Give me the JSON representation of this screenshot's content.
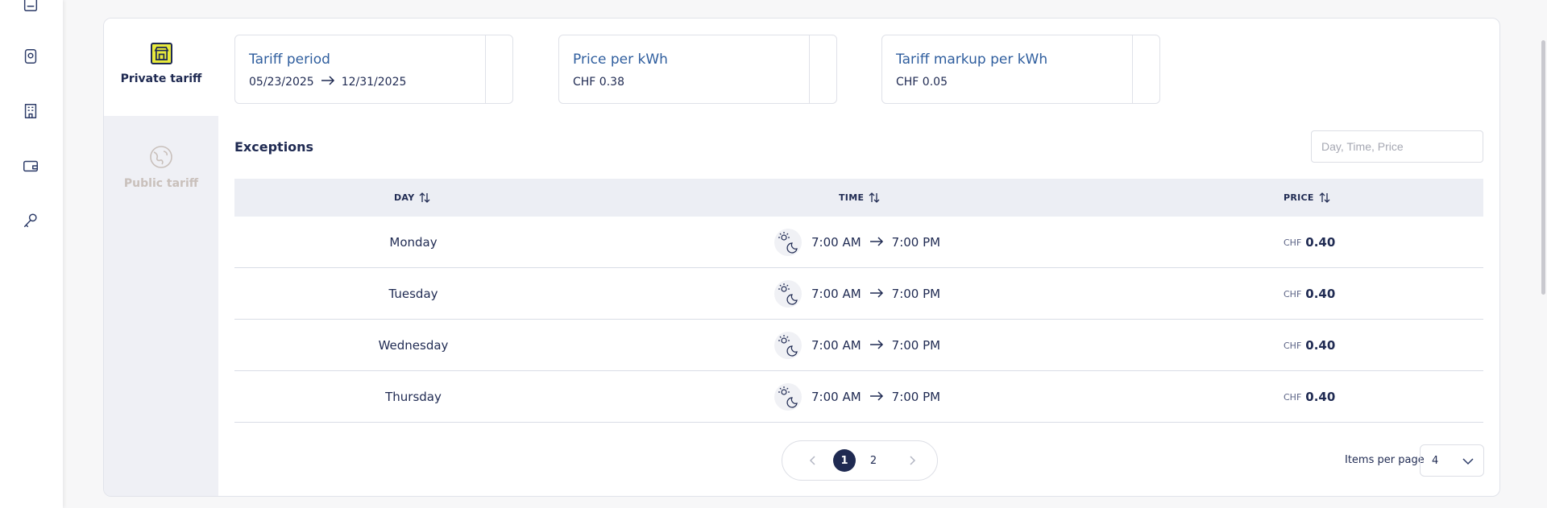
{
  "rail": {
    "icons": [
      "document-icon",
      "badge-icon",
      "building-icon",
      "wallet-icon",
      "key-icon"
    ]
  },
  "tabs": {
    "private": {
      "label": "Private tariff"
    },
    "public": {
      "label": "Public tariff"
    }
  },
  "tariff_period": {
    "title": "Tariff period",
    "start": "05/23/2025",
    "end": "12/31/2025"
  },
  "price_per_kwh": {
    "title": "Price per kWh",
    "value": "CHF 0.38"
  },
  "tariff_markup": {
    "title": "Tariff markup per kWh",
    "value": "CHF 0.05"
  },
  "exceptions": {
    "title": "Exceptions",
    "search_placeholder": "Day, Time, Price",
    "columns": {
      "day": "DAY",
      "time": "TIME",
      "price": "PRICE"
    },
    "rows": [
      {
        "day": "Monday",
        "from": "7:00 AM",
        "to": "7:00 PM",
        "currency": "CHF",
        "price": "0.40"
      },
      {
        "day": "Tuesday",
        "from": "7:00 AM",
        "to": "7:00 PM",
        "currency": "CHF",
        "price": "0.40"
      },
      {
        "day": "Wednesday",
        "from": "7:00 AM",
        "to": "7:00 PM",
        "currency": "CHF",
        "price": "0.40"
      },
      {
        "day": "Thursday",
        "from": "7:00 AM",
        "to": "7:00 PM",
        "currency": "CHF",
        "price": "0.40"
      }
    ]
  },
  "pagination": {
    "current_page": "1",
    "other_page": "2",
    "items_per_page_label": "Items per page",
    "items_per_page_value": "4"
  },
  "colors": {
    "primary": "#1f2a52",
    "link_blue": "#2f5e9e",
    "private_icon_yellow": "#e8ea3c",
    "inactive_tab_text": "#c9c0bb",
    "table_header_bg": "#eceef4"
  }
}
